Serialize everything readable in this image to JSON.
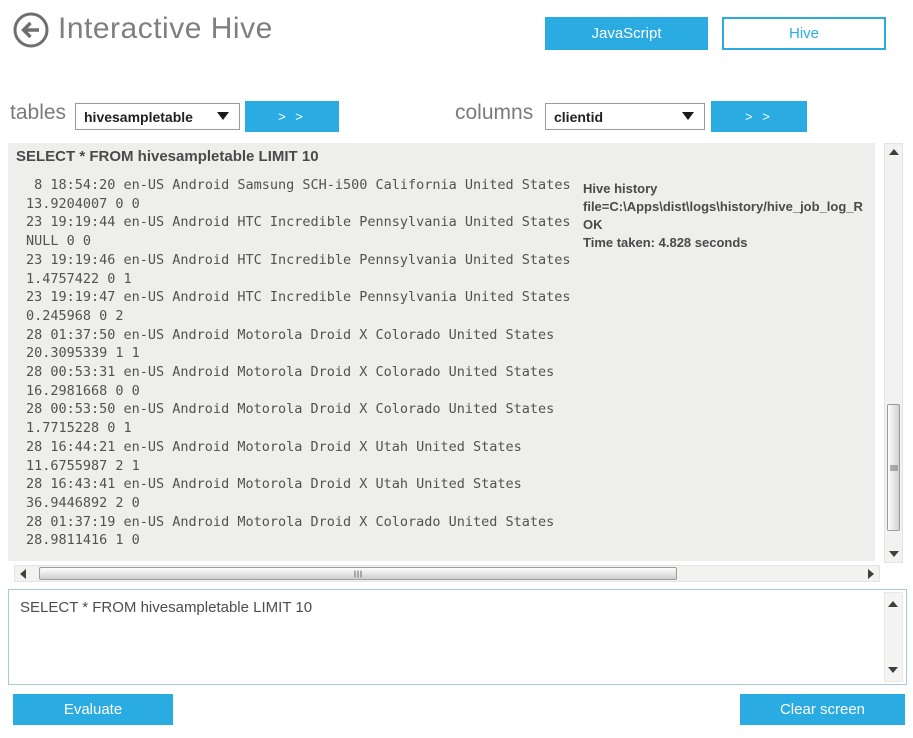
{
  "accent_color": "#2aabe2",
  "header": {
    "title": "Interactive Hive",
    "mode_buttons": {
      "javascript": "JavaScript",
      "hive": "Hive"
    }
  },
  "selectors": {
    "tables": {
      "label": "tables",
      "selected": "hivesampletable",
      "send_label": "> >"
    },
    "columns": {
      "label": "columns",
      "selected": "clientid",
      "send_label": "> >"
    }
  },
  "output": {
    "query_header": "SELECT * FROM hivesampletable LIMIT 10",
    "records": [
      " 8 18:54:20 en-US Android Samsung SCH-i500 California United States 13.9204007 0 0",
      "23 19:19:44 en-US Android HTC Incredible Pennsylvania United States NULL 0 0",
      "23 19:19:46 en-US Android HTC Incredible Pennsylvania United States 1.4757422 0 1",
      "23 19:19:47 en-US Android HTC Incredible Pennsylvania United States 0.245968 0 2",
      "28 01:37:50 en-US Android Motorola Droid X Colorado United States 20.3095339 1 1",
      "28 00:53:31 en-US Android Motorola Droid X Colorado United States 16.2981668 0 0",
      "28 00:53:50 en-US Android Motorola Droid X Colorado United States 1.7715228 0 1",
      "28 16:44:21 en-US Android Motorola Droid X Utah United States 11.6755987 2 1",
      "28 16:43:41 en-US Android Motorola Droid X Utah United States 36.9446892 2 0",
      "28 01:37:19 en-US Android Motorola Droid X Colorado United States 28.9811416 1 0"
    ],
    "history": {
      "title": "Hive history",
      "file_line": "file=C:\\Apps\\dist\\logs\\history/hive_job_log_R",
      "status": "OK",
      "time_taken": "Time taken: 4.828 seconds"
    }
  },
  "editor": {
    "value": "SELECT * FROM hivesampletable LIMIT 10"
  },
  "actions": {
    "evaluate": "Evaluate",
    "clear": "Clear screen"
  }
}
